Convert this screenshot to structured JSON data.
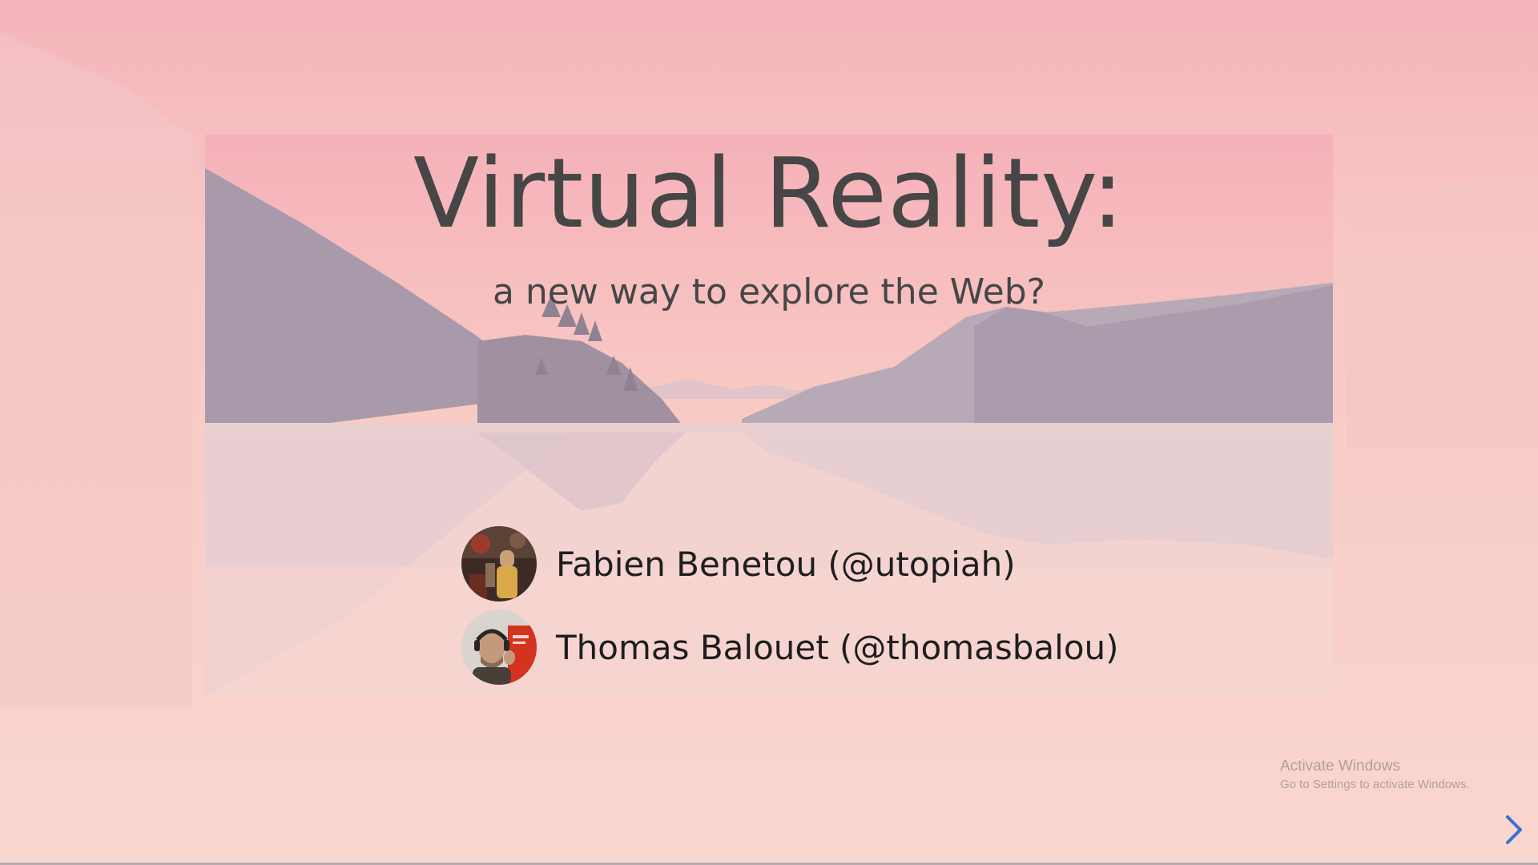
{
  "slide": {
    "title": "Virtual Reality:",
    "subtitle": "a new way to explore the Web?"
  },
  "authors": [
    {
      "name": "Fabien Benetou (@utopiah)",
      "avatar": "avatar-photo"
    },
    {
      "name": "Thomas Balouet (@thomasbalou)",
      "avatar": "avatar-photo"
    }
  ],
  "watermark": {
    "title": "Activate Windows",
    "subtitle": "Go to Settings to activate Windows."
  },
  "navigation": {
    "next_icon": "chevron-right-icon"
  },
  "colors": {
    "title_text": "#464646",
    "author_text": "#1e1e1e",
    "mountains": "#a79aae",
    "sky_top": "#f5b7bd",
    "nav_arrow": "#3a6fd0"
  }
}
